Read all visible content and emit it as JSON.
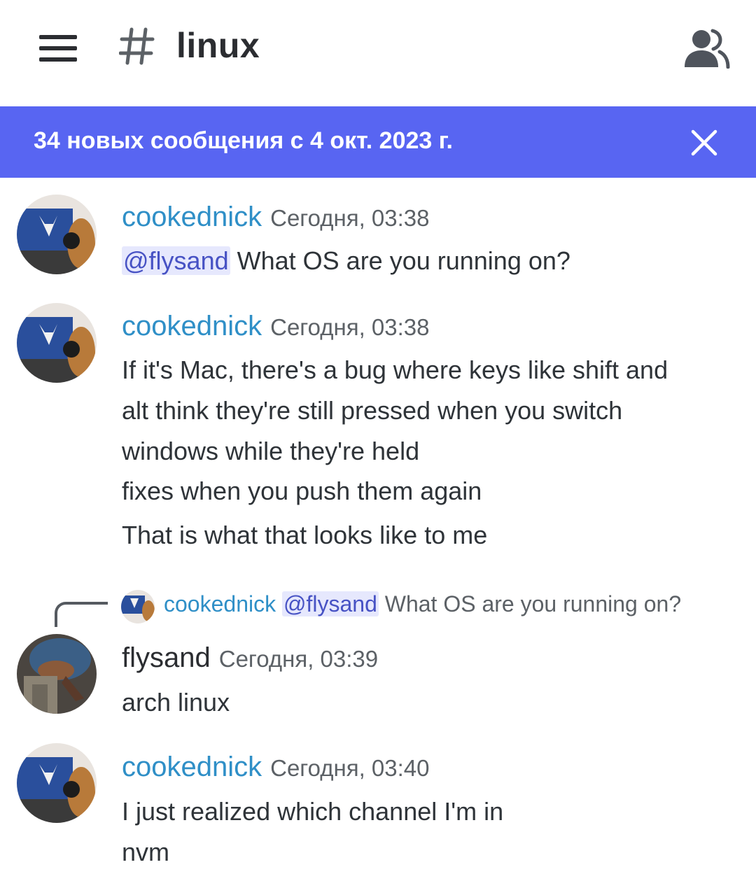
{
  "header": {
    "channel_name": "linux",
    "menu_icon": "hamburger-menu-icon",
    "channel_icon": "hash-icon",
    "members_icon": "members-icon"
  },
  "banner": {
    "text": "34 новых сообщения с 4 окт. 2023 г.",
    "close_icon": "close-icon",
    "color": "#5865f2"
  },
  "messages": [
    {
      "author": "cookednick",
      "time": "Сегодня, 03:38",
      "mention": "@flysand",
      "lines": [
        "What OS are you running on?"
      ]
    },
    {
      "author": "cookednick",
      "time": "Сегодня, 03:38",
      "lines": [
        "If it's Mac, there's a bug where keys like shift and",
        "alt think they're still pressed when you switch",
        "windows while they're held",
        "fixes when you push them again",
        "That is what that looks like to me"
      ]
    },
    {
      "reply": {
        "author": "cookednick",
        "mention": "@flysand",
        "text": "What OS are you running on?"
      },
      "author": "flysand",
      "time": "Сегодня, 03:39",
      "lines": [
        "arch linux"
      ]
    },
    {
      "author": "cookednick",
      "time": "Сегодня, 03:40",
      "lines": [
        "I just realized which channel I'm in",
        "nvm"
      ]
    }
  ],
  "colors": {
    "username": "#2f8fc7",
    "mention_bg": "#e6e8fd",
    "mention_text": "#4752c4"
  }
}
